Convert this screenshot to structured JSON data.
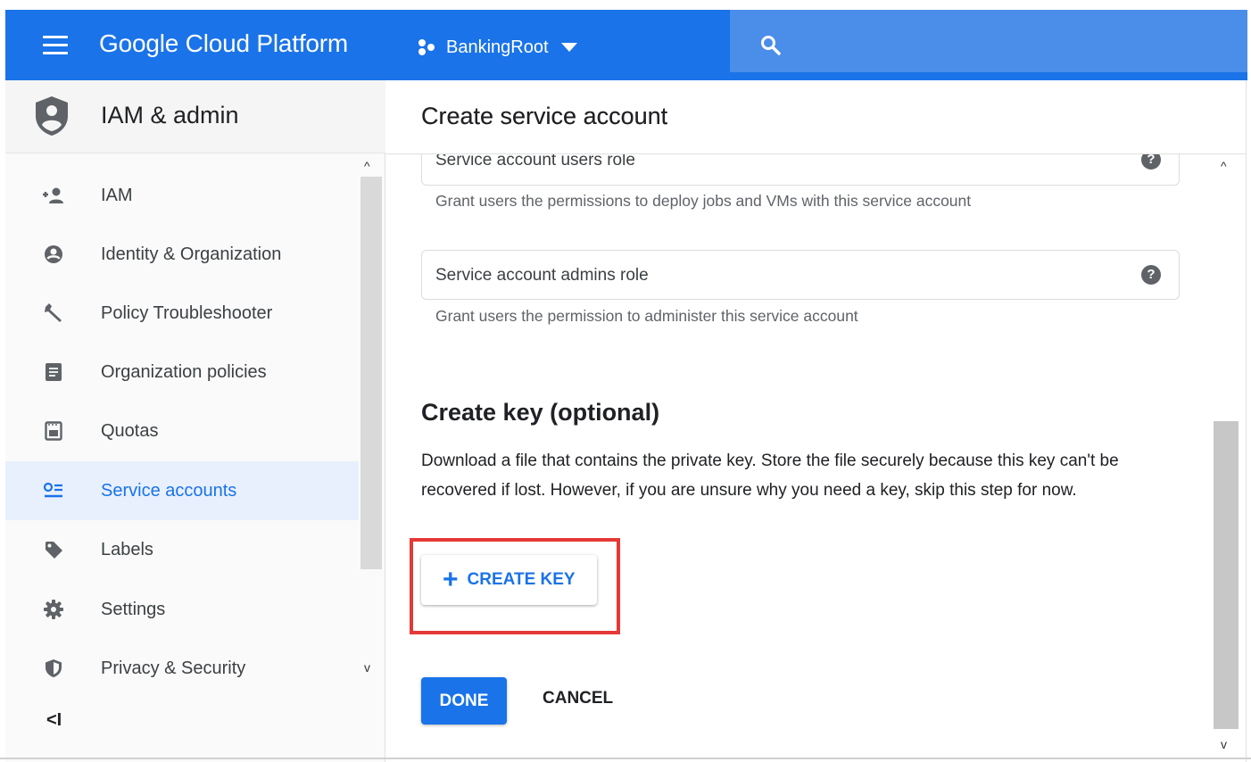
{
  "header": {
    "app_title": "Google Cloud Platform",
    "project_name": "BankingRoot",
    "brand_color": "#1a73e8"
  },
  "sidebar": {
    "section_title": "IAM & admin",
    "items": [
      {
        "label": "IAM",
        "icon": "add-person-icon"
      },
      {
        "label": "Identity & Organization",
        "icon": "account-circle-icon"
      },
      {
        "label": "Policy Troubleshooter",
        "icon": "wrench-icon"
      },
      {
        "label": "Organization policies",
        "icon": "document-icon"
      },
      {
        "label": "Quotas",
        "icon": "quota-icon"
      },
      {
        "label": "Service accounts",
        "icon": "service-account-icon",
        "active": true
      },
      {
        "label": "Labels",
        "icon": "tag-icon"
      },
      {
        "label": "Settings",
        "icon": "gear-icon"
      },
      {
        "label": "Privacy & Security",
        "icon": "shield-icon"
      }
    ],
    "collapse_label": "<I"
  },
  "main": {
    "title": "Create service account",
    "fields": [
      {
        "value": "Service account users role",
        "hint": "Grant users the permissions to deploy jobs and VMs with this service account"
      },
      {
        "value": "Service account admins role",
        "hint": "Grant users the permission to administer this service account"
      }
    ],
    "key_section": {
      "title": "Create key (optional)",
      "description": "Download a file that contains the private key. Store the file securely because this key can't be recovered if lost. However, if you are unsure why you need a key, skip this step for now.",
      "create_key_label": "CREATE KEY"
    },
    "done_label": "DONE",
    "cancel_label": "CANCEL"
  }
}
